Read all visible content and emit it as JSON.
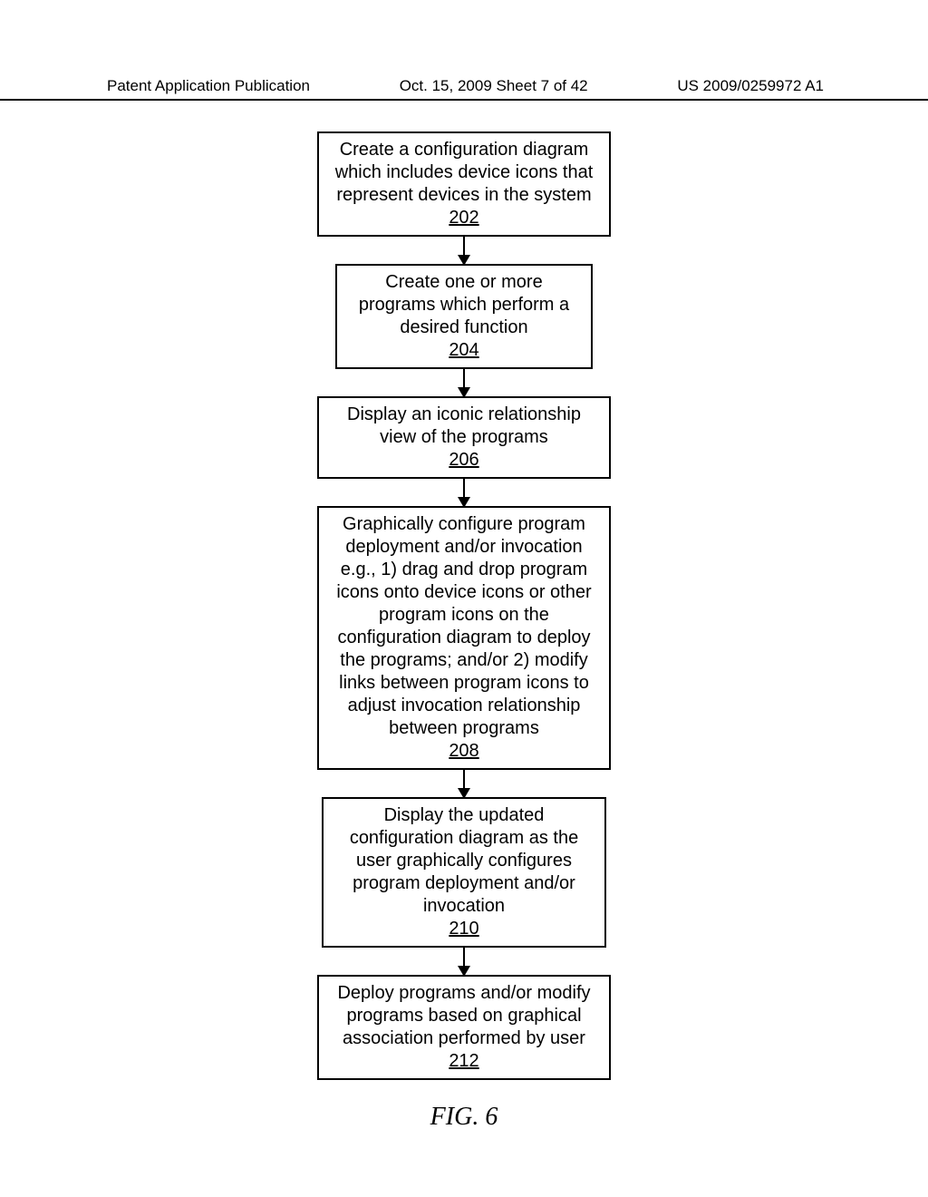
{
  "header": {
    "left": "Patent Application Publication",
    "center": "Oct. 15, 2009  Sheet 7 of 42",
    "right": "US 2009/0259972 A1"
  },
  "chart_data": {
    "type": "flowchart",
    "title": "FIG. 6",
    "nodes": [
      {
        "id": "202",
        "text": "Create a configuration diagram which includes device icons that represent devices in the system",
        "ref": "202"
      },
      {
        "id": "204",
        "text": "Create one or more programs which perform a desired function",
        "ref": "204"
      },
      {
        "id": "206",
        "text": "Display an iconic relationship view of the programs",
        "ref": "206"
      },
      {
        "id": "208",
        "text": "Graphically configure program deployment and/or invocation e.g., 1) drag and drop program icons onto device icons or other program icons on the configuration diagram to deploy the programs; and/or 2) modify links between program icons to adjust invocation relationship between programs",
        "ref": "208"
      },
      {
        "id": "210",
        "text": "Display the updated configuration diagram as the user graphically configures program deployment and/or invocation",
        "ref": "210"
      },
      {
        "id": "212",
        "text": "Deploy programs and/or modify programs based on graphical association performed by user",
        "ref": "212"
      }
    ],
    "edges": [
      [
        "202",
        "204"
      ],
      [
        "204",
        "206"
      ],
      [
        "206",
        "208"
      ],
      [
        "208",
        "210"
      ],
      [
        "210",
        "212"
      ]
    ],
    "figure_label": "FIG. 6"
  }
}
